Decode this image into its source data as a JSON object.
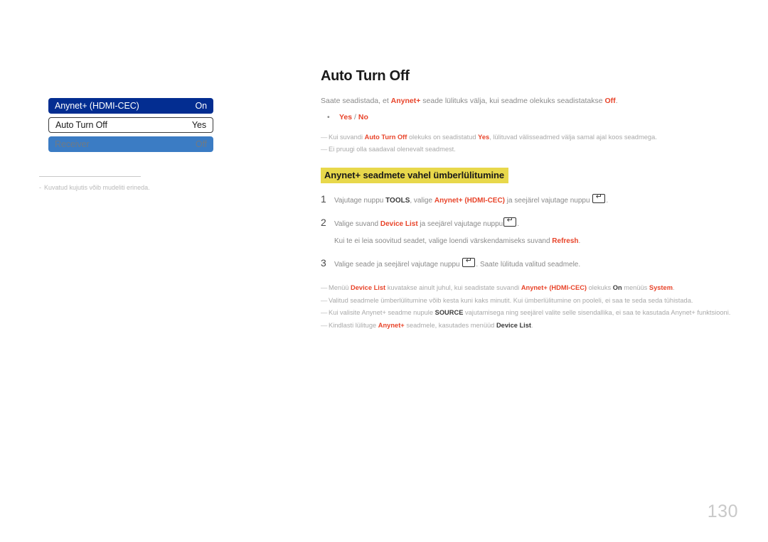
{
  "page": {
    "title": "Auto Turn Off",
    "number": "130"
  },
  "figure": {
    "rows": [
      {
        "label": "Anynet+ (HDMI-CEC)",
        "value": "On",
        "state": "selected"
      },
      {
        "label": "Auto Turn Off",
        "value": "Yes",
        "state": "active"
      },
      {
        "label": "Receiver",
        "value": "Off",
        "state": "disabled"
      }
    ],
    "caption_dash": "-",
    "caption": "Kuvatud kujutis võib mudeliti erineda."
  },
  "intro": {
    "text_1": "Saate seadistada, et ",
    "em_1": "Anynet+",
    "text_2": " seade lülituks välja, kui seadme olekuks seadistatakse ",
    "em_2": "Off",
    "text_3": "."
  },
  "bullet": {
    "dot": "•",
    "option_1": "Yes",
    "separator": " / ",
    "option_2": "No"
  },
  "intro_notes": [
    {
      "dash": "—",
      "t1": "Kui suvandi ",
      "e1": "Auto Turn Off",
      "t2": " olekuks on seadistatud ",
      "e2": "Yes",
      "t3": ", lülituvad välisseadmed välja samal ajal koos seadmega."
    },
    {
      "dash": "—",
      "t1": "Ei pruugi olla saadaval olenevalt seadmest.",
      "e1": "",
      "t2": "",
      "e2": "",
      "t3": ""
    }
  ],
  "section": {
    "heading": "Anynet+ seadmete vahel ümberlülitumine"
  },
  "steps": [
    {
      "num": "1",
      "t1": "Vajutage nuppu ",
      "b1": "TOOLS",
      "t2": ", valige ",
      "e1": "Anynet+ (HDMI-CEC)",
      "t3": " ja seejärel vajutage nuppu ",
      "key": "enter-key-icon",
      "t4": "."
    },
    {
      "num": "2",
      "t1": "Valige suvand ",
      "b1": "",
      "t2": "",
      "e1": "Device List",
      "t3": " ja seejärel vajutage nuppu",
      "key": "enter-key-icon",
      "t4": "."
    },
    {
      "num": "3",
      "t1": "Valige seade ja seejärel vajutage nuppu ",
      "b1": "",
      "t2": "",
      "e1": "",
      "t3": "",
      "key": "enter-key-icon",
      "t4": ". Saate lülituda valitud seadmele."
    }
  ],
  "sub_step": {
    "t1": "Kui te ei leia soovitud seadet, valige loendi värskendamiseks suvand ",
    "e1": "Refresh",
    "t2": "."
  },
  "notes": [
    {
      "dash": "—",
      "t1": "Menüü ",
      "e1": "Device List",
      "t2": " kuvatakse ainult juhul, kui seadistate suvandi ",
      "e2": "Anynet+ (HDMI-CEC)",
      "t3": " olekuks ",
      "e3": "On",
      "t4": " menüüs ",
      "e4": "System",
      "t5": "."
    },
    {
      "dash": "—",
      "t1": "Valitud seadmele ümberlülitumine võib kesta kuni kaks minutit. Kui ümberlülitumine on pooleli, ei saa te seda seda tühistada.",
      "e1": "",
      "t2": "",
      "e2": "",
      "t3": "",
      "e3": "",
      "t4": "",
      "e4": "",
      "t5": ""
    },
    {
      "dash": "—",
      "t1": "Kui valisite Anynet+ seadme nupule ",
      "e1": "",
      "t2": "",
      "e2": "",
      "t3": "",
      "e3": "",
      "t4": "",
      "e4": "",
      "t5": ""
    },
    {
      "dash": "—",
      "t1": "Kindlasti lülituge ",
      "e1": "Anynet+",
      "t2": " seadmele, kasutades menüüd ",
      "e2": "Device List",
      "t3": ".",
      "e3": "",
      "t4": "",
      "e4": "",
      "t5": ""
    }
  ],
  "note_source": {
    "bold": "SOURCE",
    "tail": " vajutamisega ning seejärel valite selle sisendallika, ei saa te kasutada Anynet+ funktsiooni."
  },
  "colors": {
    "accent_red": "#e8442a",
    "highlight_yellow": "#e8d84b",
    "menu_selected_blue": "#032d91",
    "menu_disabled_blue": "#3b7cc4",
    "body_gray": "#8a8a8a"
  }
}
